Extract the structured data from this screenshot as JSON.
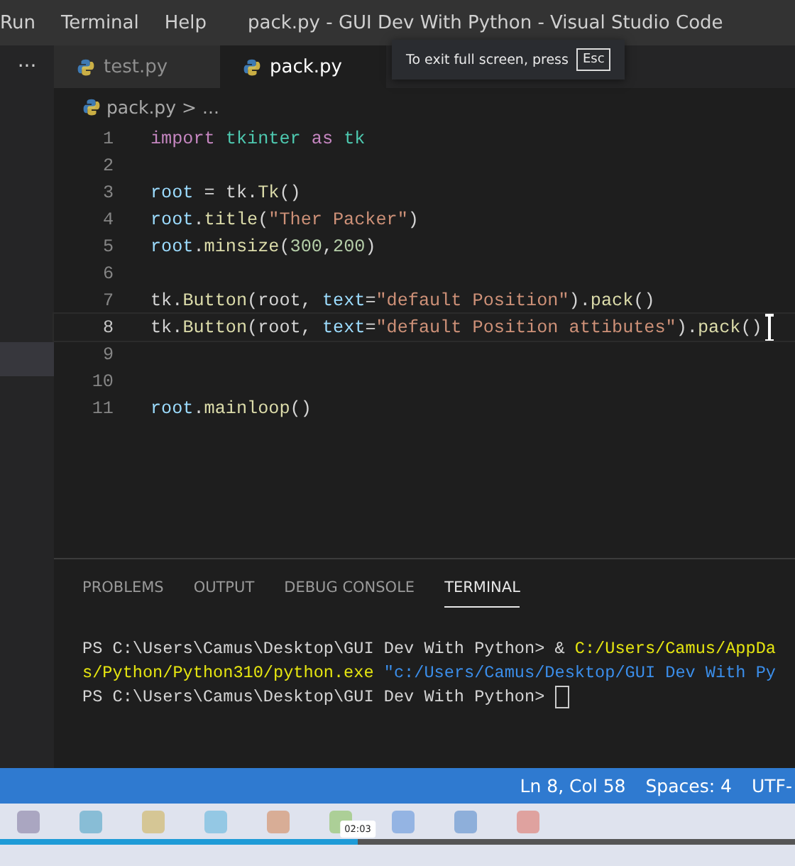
{
  "menu": [
    "Run",
    "Terminal",
    "Help"
  ],
  "window": {
    "title": "pack.py - GUI Dev With Python - Visual Studio Code"
  },
  "fullscreen_notice": {
    "text": "To exit full screen, press",
    "key": "Esc"
  },
  "more_actions": "···",
  "tabs": [
    {
      "label": "test.py",
      "selected": false
    },
    {
      "label": "pack.py",
      "selected": true
    }
  ],
  "breadcrumb": {
    "file": "pack.py",
    "separator": ">",
    "rest": "..."
  },
  "code": [
    {
      "number": "1",
      "current": false,
      "tokens": [
        {
          "kind": "keyword",
          "text": "import"
        },
        {
          "kind": "module",
          "text": " tkinter"
        },
        {
          "kind": "keyword",
          "text": " as"
        },
        {
          "kind": "module",
          "text": " tk"
        }
      ]
    },
    {
      "number": "2",
      "current": false
    },
    {
      "number": "3",
      "current": false,
      "tokens": [
        {
          "kind": "variable",
          "text": "root"
        },
        {
          "kind": "plain",
          "text": " = tk."
        },
        {
          "kind": "function",
          "text": "Tk"
        },
        {
          "kind": "plain",
          "text": "()"
        }
      ]
    },
    {
      "number": "4",
      "current": false,
      "tokens": [
        {
          "kind": "variable",
          "text": "root"
        },
        {
          "kind": "plain",
          "text": "."
        },
        {
          "kind": "function",
          "text": "title"
        },
        {
          "kind": "plain",
          "text": "("
        },
        {
          "kind": "string",
          "text": "\"Ther Packer\""
        },
        {
          "kind": "plain",
          "text": ")"
        }
      ]
    },
    {
      "number": "5",
      "current": false,
      "tokens": [
        {
          "kind": "variable",
          "text": "root"
        },
        {
          "kind": "plain",
          "text": "."
        },
        {
          "kind": "function",
          "text": "minsize"
        },
        {
          "kind": "plain",
          "text": "("
        },
        {
          "kind": "number",
          "text": "300"
        },
        {
          "kind": "plain",
          "text": ","
        },
        {
          "kind": "number",
          "text": "200"
        },
        {
          "kind": "plain",
          "text": ")"
        }
      ]
    },
    {
      "number": "6",
      "current": false
    },
    {
      "number": "7",
      "current": false,
      "tokens": [
        {
          "kind": "plain",
          "text": "tk."
        },
        {
          "kind": "function",
          "text": "Button"
        },
        {
          "kind": "plain",
          "text": "(root, "
        },
        {
          "kind": "variable",
          "text": "text"
        },
        {
          "kind": "plain",
          "text": "="
        },
        {
          "kind": "string",
          "text": "\"default Position\""
        },
        {
          "kind": "plain",
          "text": ")."
        },
        {
          "kind": "function",
          "text": "pack"
        },
        {
          "kind": "plain",
          "text": "()"
        }
      ]
    },
    {
      "number": "8",
      "current": true,
      "tokens": [
        {
          "kind": "plain",
          "text": "tk."
        },
        {
          "kind": "function",
          "text": "Button"
        },
        {
          "kind": "plain",
          "text": "(root, "
        },
        {
          "kind": "variable",
          "text": "text"
        },
        {
          "kind": "plain",
          "text": "="
        },
        {
          "kind": "string",
          "text": "\"default Position attibutes\""
        },
        {
          "kind": "plain",
          "text": ")."
        },
        {
          "kind": "function",
          "text": "pack"
        },
        {
          "kind": "plain",
          "text": "()"
        }
      ]
    },
    {
      "number": "9",
      "current": false
    },
    {
      "number": "10",
      "current": false
    },
    {
      "number": "11",
      "current": false,
      "tokens": [
        {
          "kind": "variable",
          "text": "root"
        },
        {
          "kind": "plain",
          "text": "."
        },
        {
          "kind": "function",
          "text": "mainloop"
        },
        {
          "kind": "plain",
          "text": "()"
        }
      ]
    }
  ],
  "panel_tabs": [
    {
      "label": "PROBLEMS",
      "selected": false
    },
    {
      "label": "OUTPUT",
      "selected": false
    },
    {
      "label": "DEBUG CONSOLE",
      "selected": false
    },
    {
      "label": "TERMINAL",
      "selected": true
    }
  ],
  "terminal": [
    {
      "cursor": false,
      "tokens": [
        {
          "kind": "plain",
          "text": "PS C:\\Users\\Camus\\Desktop\\GUI Dev With Python> & "
        },
        {
          "kind": "path",
          "text": "C:/Users/Camus/AppDa"
        }
      ]
    },
    {
      "cursor": false,
      "tokens": [
        {
          "kind": "path",
          "text": "s/Python/Python310/python.exe"
        },
        {
          "kind": "string",
          "text": " \"c:/Users/Camus/Desktop/GUI Dev With Py"
        }
      ]
    },
    {
      "cursor": true,
      "tokens": [
        {
          "kind": "plain",
          "text": "PS C:\\Users\\Camus\\Desktop\\GUI Dev With Python> "
        }
      ]
    }
  ],
  "status_bar": [
    "Ln 8, Col 58",
    "Spaces: 4",
    "UTF-"
  ],
  "video_progress": {
    "level": 0.45,
    "time": "02:03"
  }
}
